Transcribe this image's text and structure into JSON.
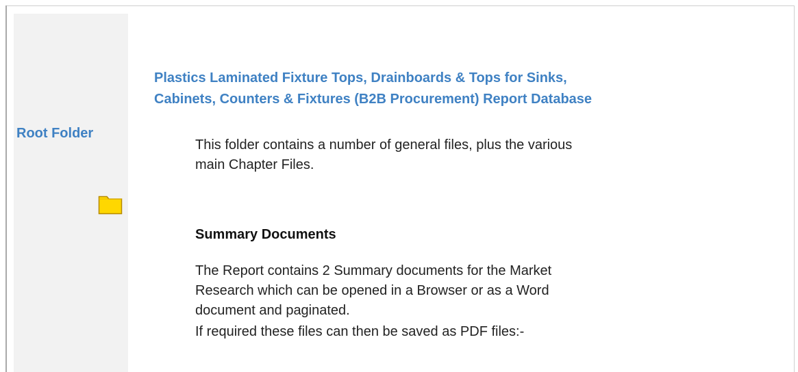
{
  "sidebar": {
    "title": "Root Folder",
    "folder_icon": "folder-icon",
    "folder_color": "#ffd700",
    "background": "#f2f2f2"
  },
  "main": {
    "title_lines": [
      "Plastics Laminated Fixture Tops, Drainboards & Tops for Sinks,",
      "Cabinets, Counters & Fixtures (B2B Procurement) Report Database"
    ],
    "intro_lines": [
      "This folder contains a number of general files, plus the various",
      "main Chapter Files."
    ],
    "summary_heading": "Summary Documents",
    "summary_lines": [
      "The Report contains 2 Summary documents for the Market",
      "Research which can be opened in a Browser or as a Word",
      "document and paginated."
    ],
    "pdf_note": "If required these files can then be saved as PDF files:-"
  },
  "colors": {
    "accent": "#3f81c3",
    "text": "#222222"
  }
}
